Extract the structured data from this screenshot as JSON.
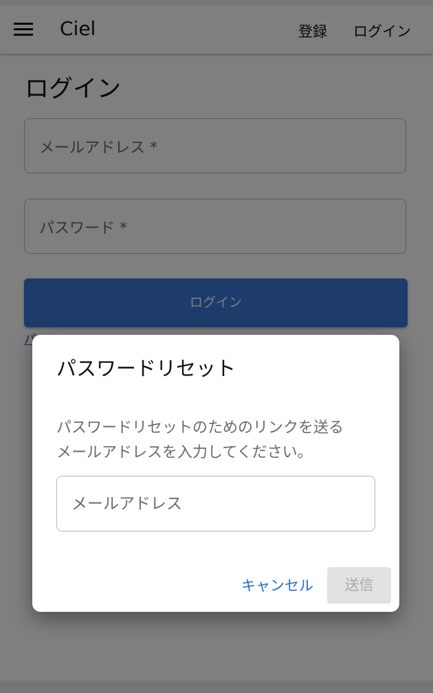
{
  "appbar": {
    "brand": "Ciel",
    "menu_icon": "hamburger-icon",
    "nav": {
      "register": "登録",
      "login": "ログイン"
    }
  },
  "page": {
    "title": "ログイン",
    "email_label": "メールアドレス *",
    "password_label": "パスワード *",
    "login_button": "ログイン",
    "forgot_link": "パ"
  },
  "dialog": {
    "title": "パスワードリセット",
    "text_line1": "パスワードリセットのためのリンクを送る",
    "text_line2": "メールアドレスを入力してください。",
    "email_placeholder": "メールアドレス",
    "email_value": "",
    "cancel_button": "キャンセル",
    "submit_button": "送信"
  },
  "colors": {
    "primary": "#3b78d8",
    "link": "#1f6fc5",
    "disabled_bg": "#e2e2e2",
    "disabled_text": "#a9a9a9"
  }
}
